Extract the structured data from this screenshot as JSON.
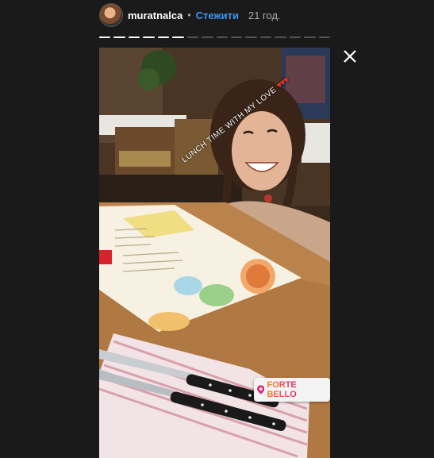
{
  "header": {
    "username": "muratnalca",
    "separator": "•",
    "follow_label": "Стежити",
    "time_ago": "21 год."
  },
  "progress": {
    "total_segments": 16,
    "completed_segments": 6
  },
  "story": {
    "caption": "LUNCH TIME WITH MY LOVE",
    "location_sticker": "FORTE BELLO"
  },
  "icons": {
    "close": "close-icon",
    "location": "location-pin-icon",
    "avatar": "avatar"
  },
  "colors": {
    "background": "#1a1a1a",
    "follow": "#3897f0",
    "username": "#ffffff"
  }
}
